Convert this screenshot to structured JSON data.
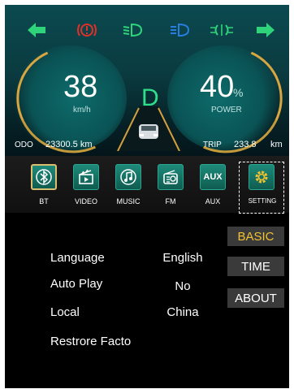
{
  "indicators": {
    "colors": {
      "left": "#2fd47a",
      "warn": "#e0302a",
      "low": "#2fd47a",
      "high": "#2a7de0",
      "fog": "#2fd47a",
      "right": "#2fd47a"
    }
  },
  "dashboard": {
    "speed_value": "38",
    "speed_unit": "km/h",
    "gear": "D",
    "power_value": "40",
    "power_pct": "%",
    "power_label": "POWER",
    "odo_label": "ODO",
    "odo_value": "23300.5 km",
    "trip_label": "TRIP",
    "trip_value": "233.8",
    "trip_unit": "km"
  },
  "apps": [
    {
      "label": "BT",
      "icon": "bluetooth-icon"
    },
    {
      "label": "VIDEO",
      "icon": "video-icon"
    },
    {
      "label": "MUSIC",
      "icon": "music-icon"
    },
    {
      "label": "FM",
      "icon": "radio-icon"
    },
    {
      "label": "AUX",
      "icon": "aux-icon",
      "glyph": "AUX"
    },
    {
      "label": "SETTING",
      "icon": "gear-icon"
    }
  ],
  "settings": {
    "rows": [
      {
        "label": "Language",
        "value": "English"
      },
      {
        "label": "Auto Play",
        "value": "No"
      },
      {
        "label": "Local",
        "value": "China"
      },
      {
        "label": "Restrore Facto",
        "value": ""
      }
    ],
    "tabs": [
      {
        "label": "BASIC",
        "active": true
      },
      {
        "label": "TIME",
        "active": false
      },
      {
        "label": "ABOUT",
        "active": false
      }
    ]
  },
  "accent": "#f2c230"
}
